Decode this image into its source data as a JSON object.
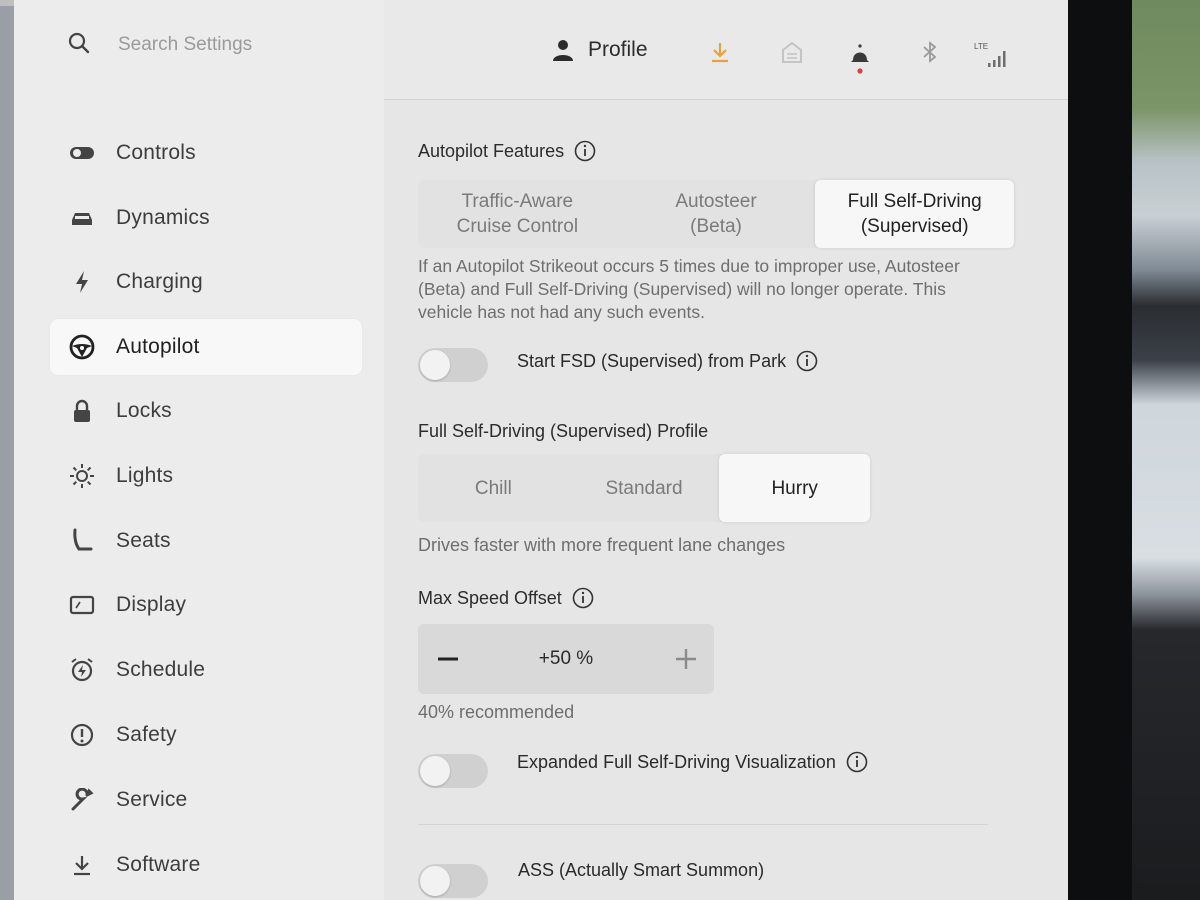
{
  "header": {
    "search_placeholder": "Search Settings",
    "profile_label": "Profile",
    "network_label": "LTE",
    "download_color": "#e8a23a",
    "alert_dot_color": "#d9413a"
  },
  "sidebar": {
    "items": [
      {
        "label": "Controls",
        "icon": "toggle-icon"
      },
      {
        "label": "Dynamics",
        "icon": "car-icon"
      },
      {
        "label": "Charging",
        "icon": "lightning-icon"
      },
      {
        "label": "Autopilot",
        "icon": "steering-wheel-icon",
        "active": true
      },
      {
        "label": "Locks",
        "icon": "lock-icon"
      },
      {
        "label": "Lights",
        "icon": "sun-icon"
      },
      {
        "label": "Seats",
        "icon": "seat-icon"
      },
      {
        "label": "Display",
        "icon": "display-icon"
      },
      {
        "label": "Schedule",
        "icon": "alarm-clock-icon"
      },
      {
        "label": "Safety",
        "icon": "alert-circle-icon"
      },
      {
        "label": "Service",
        "icon": "wrench-icon"
      },
      {
        "label": "Software",
        "icon": "download-icon"
      }
    ]
  },
  "autopilot": {
    "features_title": "Autopilot Features",
    "features_options": [
      {
        "label": "Traffic-Aware\nCruise Control"
      },
      {
        "label": "Autosteer\n(Beta)"
      },
      {
        "label": "Full Self-Driving\n(Supervised)",
        "selected": true
      }
    ],
    "strikeout_text": "If an Autopilot Strikeout occurs 5 times due to improper use, Autosteer (Beta) and Full Self-Driving (Supervised) will no longer operate. This vehicle has not had any such events.",
    "start_from_park_label": "Start FSD (Supervised) from Park",
    "profile_title": "Full Self-Driving (Supervised) Profile",
    "profile_options": [
      {
        "label": "Chill"
      },
      {
        "label": "Standard"
      },
      {
        "label": "Hurry",
        "selected": true
      }
    ],
    "profile_description": "Drives faster with more frequent lane changes",
    "max_speed_title": "Max Speed Offset",
    "max_speed_value": "+50 %",
    "max_speed_recommendation": "40% recommended",
    "expanded_viz_label": "Expanded Full Self-Driving Visualization",
    "smart_summon_label": "ASS (Actually Smart Summon)",
    "toggles": {
      "start_from_park": false,
      "expanded_viz": false,
      "smart_summon": false
    }
  }
}
